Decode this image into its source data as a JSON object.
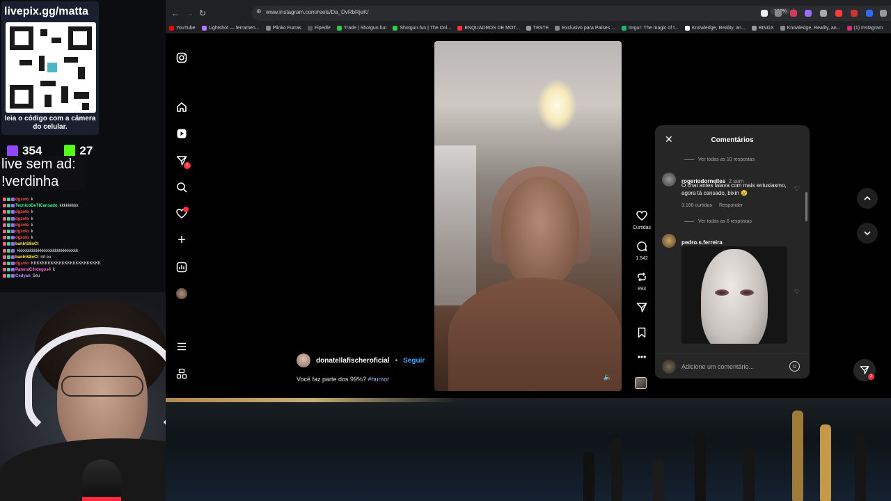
{
  "browser": {
    "url": "www.instagram.com/reels/Da_DvRbRjeK/",
    "zoom": "120%",
    "bookmarks": [
      {
        "label": "YouTube",
        "color": "#ff0000"
      },
      {
        "label": "Lightshot — ferramen...",
        "color": "#b07cff"
      },
      {
        "label": "Plinko Furras",
        "color": "#888888"
      },
      {
        "label": "Fipedle",
        "color": "#555555"
      },
      {
        "label": "Trade | Shotgun.fun",
        "color": "#2ecc40"
      },
      {
        "label": "Shotgun.fun | The Onl...",
        "color": "#2ecc40"
      },
      {
        "label": "ENQUADROS DE MOT...",
        "color": "#ff3030"
      },
      {
        "label": "TESTE",
        "color": "#999999"
      },
      {
        "label": "Exclusivo para Países ...",
        "color": "#888888"
      },
      {
        "label": "Imgur: The magic of t...",
        "color": "#1bb76e"
      },
      {
        "label": "Knowledge, Reality, an...",
        "color": "#ffffff"
      },
      {
        "label": "BINGX",
        "color": "#999999"
      },
      {
        "label": "Knowledge, Reality, an...",
        "color": "#888888"
      },
      {
        "label": "(1) Instagram",
        "color": "#d62976"
      }
    ]
  },
  "instagram": {
    "reel": {
      "author": "donatellafischeroficial",
      "separator": "•",
      "follow_label": "Seguir",
      "caption_text": "Você faz parte dos 99%?",
      "caption_hashtag": "#humor"
    },
    "actions": {
      "likes_label": "Curtidas",
      "comments_count": "1.542",
      "reposts_count": "893"
    },
    "comments_panel": {
      "title": "Comentários",
      "view_replies_1": "Ver todas as 10 respostas",
      "comment_1": {
        "user": "rogeriodornelles",
        "time": "2 sem",
        "text": "O chat antes falava com mais entusiasmo, agora tá cansado, bixin 😢",
        "likes": "3.168 curtidas",
        "reply": "Responder"
      },
      "view_replies_2": "Ver todas as 6 respostas",
      "comment_2": {
        "user": "pedro.s.ferreira"
      },
      "input_placeholder": "Adicione um comentário..."
    },
    "dm_badge": "2",
    "sidebar_badge": "2"
  },
  "overlay": {
    "pix_title": "livepix.gg/matta",
    "pix_subtitle": "leia o código com a câmera do celular.",
    "twitch_viewers": "354",
    "kick_viewers": "27",
    "ad_text_line1": "live sem ad:",
    "ad_text_line2": "!verdinha",
    "chat": [
      {
        "user": "dgzoto",
        "msg": "k",
        "color": "#ff4d4d"
      },
      {
        "user": "TecnicoDeTICansado",
        "msg": "kkkkkkkkk",
        "color": "#39ff88"
      },
      {
        "user": "dgzoto",
        "msg": "k",
        "color": "#ff4d4d"
      },
      {
        "user": "dgzoto",
        "msg": "k",
        "color": "#ff4d4d"
      },
      {
        "user": "dgzoto",
        "msg": "k",
        "color": "#ff4d4d"
      },
      {
        "user": "dgzoto",
        "msg": "k",
        "color": "#ff4d4d"
      },
      {
        "user": "dgzoto",
        "msg": "k",
        "color": "#ff4d4d"
      },
      {
        "user": "banInS8nCt",
        "msg": "",
        "color": "#ffe14d"
      },
      {
        "user": "",
        "msg": "kkkkkkkkkkkkkkkkkkkkkkkkkkkkk",
        "color": "#ffffff"
      },
      {
        "user": "banInS8nCt",
        "msg": "mt eu",
        "color": "#ffe14d"
      },
      {
        "user": "dgzoto",
        "msg": "KKKKKKKKKKKKKKKKKKKKKKKKK",
        "color": "#ff4d4d"
      },
      {
        "user": "PaneraC0rdegos4",
        "msg": "k",
        "color": "#ff66cc"
      },
      {
        "user": "Cedyan",
        "msg": "Seu",
        "color": "#c38bff"
      }
    ]
  }
}
